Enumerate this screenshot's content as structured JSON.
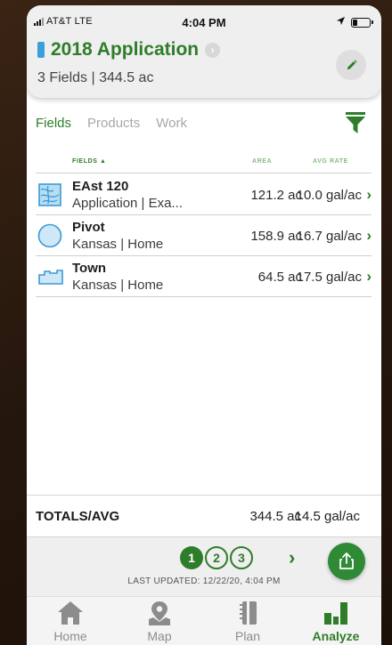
{
  "status_bar": {
    "carrier": "AT&T  LTE",
    "time": "4:04 PM",
    "location_icon": "location-arrow-icon",
    "battery_level": 0.3
  },
  "header": {
    "title": "2018 Application",
    "marker_color": "#3aa0dc",
    "subtitle": "3 Fields | 344.5 ac",
    "edit_icon": "pencil-icon"
  },
  "tabs": [
    {
      "label": "Fields",
      "active": true
    },
    {
      "label": "Products",
      "active": false
    },
    {
      "label": "Work",
      "active": false
    }
  ],
  "table": {
    "columns": {
      "fields": "FIELDS ▲",
      "area": "AREA",
      "avg_rate": "AVG RATE"
    },
    "rows": [
      {
        "name": "EAst 120",
        "sub": "Application | Exa...",
        "area": "121.2 ac",
        "rate": "10.0 gal/ac",
        "icon": "field-map-icon"
      },
      {
        "name": "Pivot",
        "sub": "Kansas | Home",
        "area": "158.9 ac",
        "rate": "16.7 gal/ac",
        "icon": "pivot-circle-icon"
      },
      {
        "name": "Town",
        "sub": "Kansas | Home",
        "area": "64.5 ac",
        "rate": "17.5 gal/ac",
        "icon": "field-outline-icon"
      }
    ]
  },
  "totals": {
    "label": "TOTALS/AVG",
    "area": "344.5 ac",
    "rate": "14.5 gal/ac"
  },
  "pager": {
    "pages": [
      "1",
      "2",
      "3"
    ],
    "current": "1",
    "last_updated": "LAST UPDATED: 12/22/20, 4:04 PM"
  },
  "nav": [
    {
      "label": "Home",
      "icon": "home-icon",
      "active": false
    },
    {
      "label": "Map",
      "icon": "map-pin-icon",
      "active": false
    },
    {
      "label": "Plan",
      "icon": "notebook-icon",
      "active": false
    },
    {
      "label": "Analyze",
      "icon": "bar-chart-icon",
      "active": true
    }
  ],
  "colors": {
    "brand_green": "#2f7d2a",
    "header_bg": "#efefef",
    "accent_blue": "#3aa0dc"
  }
}
